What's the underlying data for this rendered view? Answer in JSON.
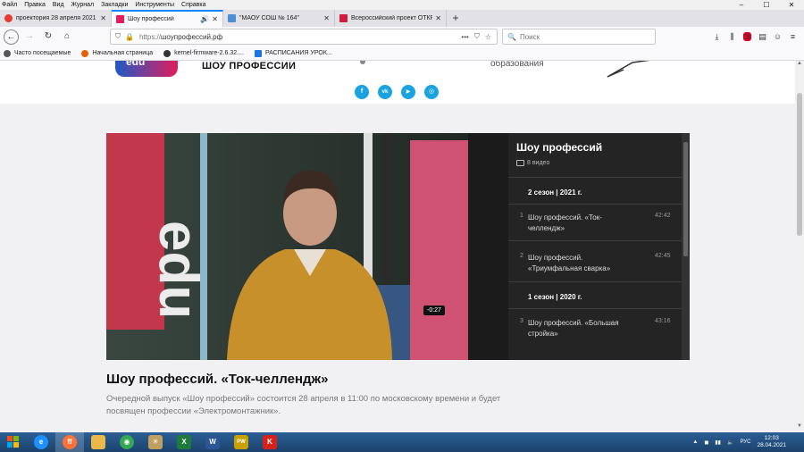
{
  "menubar": {
    "items": [
      "Файл",
      "Правка",
      "Вид",
      "Журнал",
      "Закладки",
      "Инструменты",
      "Справка"
    ]
  },
  "window_controls": {
    "minimize": "–",
    "maximize": "☐",
    "close": "✕"
  },
  "tabs": [
    {
      "label": "проектория 28 апреля 2021 —",
      "favicon_color": "#e63b2e",
      "active": false
    },
    {
      "label": "Шоу профессий",
      "favicon_color": "#e11d5c",
      "active": true,
      "audio": true
    },
    {
      "label": "\"МАОУ СОШ № 164\"",
      "favicon_color": "#4a90d9",
      "active": false
    },
    {
      "label": "Всероссийский проект ОТКРЫ",
      "favicon_color": "#d11c3c",
      "active": false
    }
  ],
  "new_tab": "+",
  "nav": {
    "url_prefix": "https://",
    "url_host": "шоупрофессий.рф",
    "search_placeholder": "Поиск",
    "notification_count": "3"
  },
  "bookmarks": [
    {
      "label": "Часто посещаемые",
      "color": "#555"
    },
    {
      "label": "Начальная страница",
      "color": "#e66000"
    },
    {
      "label": "kernel-firmware-2.6.32....",
      "color": "#333"
    },
    {
      "label": "РАСПИСАНИЯ УРОК...",
      "color": "#1a73e8"
    }
  ],
  "site": {
    "logo_text": "edu",
    "name": "ШОУ ПРОФЕССИИ",
    "partner_text": "образования",
    "socials": [
      {
        "name": "facebook-icon",
        "glyph": "f"
      },
      {
        "name": "vk-icon",
        "glyph": "vk"
      },
      {
        "name": "youtube-icon",
        "glyph": "▶"
      },
      {
        "name": "instagram-icon",
        "glyph": "◎"
      }
    ]
  },
  "player": {
    "time_remaining": "-0:27"
  },
  "playlist": {
    "title": "Шоу профессий",
    "video_count": "8 видео",
    "seasons": [
      {
        "label": "2 сезон | 2021 г.",
        "episodes": [
          {
            "num": "1",
            "name": "Шоу профессий. «Ток-челлендж»",
            "duration": "42:42"
          },
          {
            "num": "2",
            "name": "Шоу профессий. «Триумфальная сварка»",
            "duration": "42:45"
          }
        ]
      },
      {
        "label": "1 сезон | 2020 г.",
        "episodes": [
          {
            "num": "3",
            "name": "Шоу профессий. «Большая стройка»",
            "duration": "43:16"
          }
        ]
      }
    ]
  },
  "article": {
    "title": "Шоу профессий. «Ток-челлендж»",
    "description": "Очередной выпуск «Шоу профессий» состоится 28 апреля в 11:00 по московскому времени и будет посвящен профессии «Электромонтажник»."
  },
  "taskbar": {
    "apps": [
      {
        "name": "ie-icon",
        "glyph": "e",
        "color": "#1e90ff"
      },
      {
        "name": "firefox-icon",
        "glyph": "ff",
        "color": "#ff7139",
        "active": true
      },
      {
        "name": "explorer-icon",
        "glyph": "📁",
        "color": "#e8b84a"
      },
      {
        "name": "chrome-icon",
        "glyph": "◉",
        "color": "#34a853"
      },
      {
        "name": "network-app-icon",
        "glyph": "✳",
        "color": "#c0a060"
      },
      {
        "name": "excel-icon",
        "glyph": "X",
        "color": "#1f7a3e"
      },
      {
        "name": "word-icon",
        "glyph": "W",
        "color": "#2b5797"
      },
      {
        "name": "paintnet-icon",
        "glyph": "PW",
        "color": "#c8a000"
      },
      {
        "name": "kaspersky-icon",
        "glyph": "K",
        "color": "#d5231c"
      }
    ],
    "lang": "РУС",
    "time": "12:03",
    "date": "28.04.2021"
  }
}
